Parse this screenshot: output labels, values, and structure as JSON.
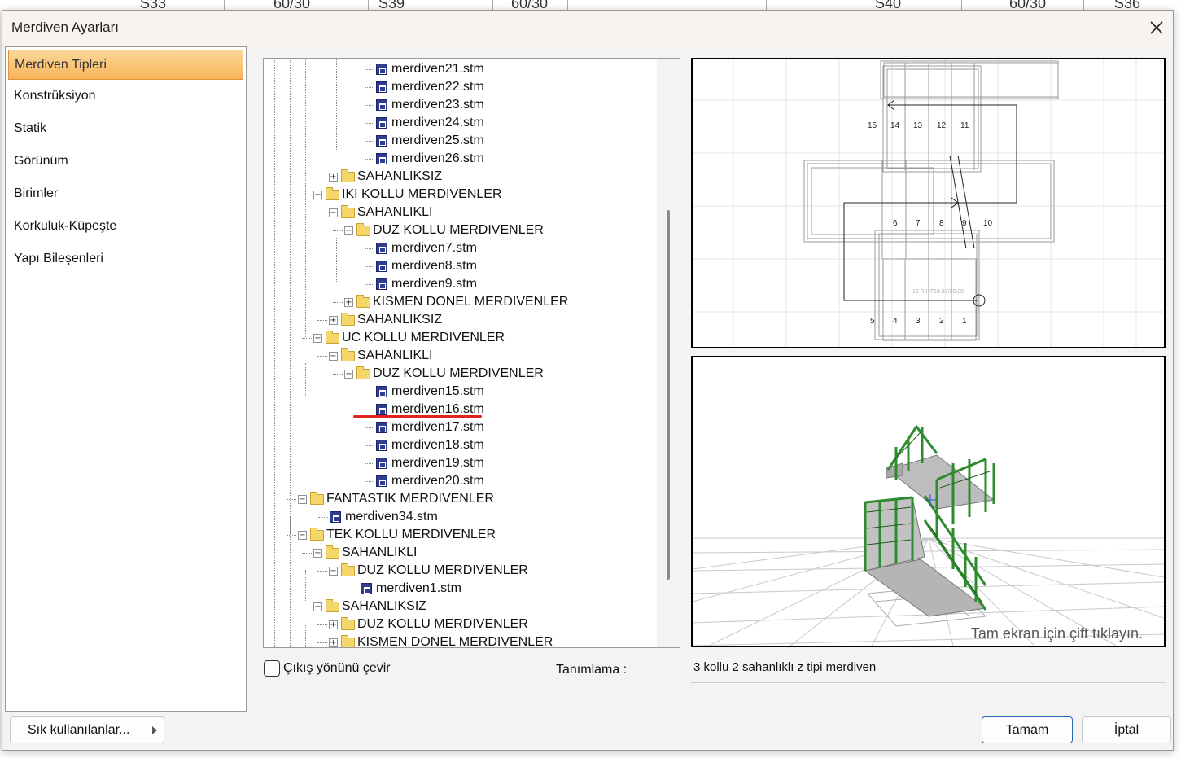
{
  "background": {
    "ruler_labels": [
      "S33",
      "60/30",
      "S39",
      "60/30",
      "S40",
      "60/30",
      "S36"
    ]
  },
  "dialog": {
    "title": "Merdiven Ayarları",
    "close_icon": "close-icon"
  },
  "sidebar": {
    "items": [
      {
        "label": "Merdiven Tipleri",
        "active": true
      },
      {
        "label": "Konstrüksiyon"
      },
      {
        "label": "Statik"
      },
      {
        "label": "Görünüm"
      },
      {
        "label": "Birimler"
      },
      {
        "label": "Korkuluk-Küpeşte"
      },
      {
        "label": "Yapı Bileşenleri"
      }
    ]
  },
  "tree": {
    "nodes": [
      {
        "label": "merdiven21.stm",
        "type": "file"
      },
      {
        "label": "merdiven22.stm",
        "type": "file"
      },
      {
        "label": "merdiven23.stm",
        "type": "file"
      },
      {
        "label": "merdiven24.stm",
        "type": "file"
      },
      {
        "label": "merdiven25.stm",
        "type": "file"
      },
      {
        "label": "merdiven26.stm",
        "type": "file"
      },
      {
        "label": "SAHANLIKSIZ",
        "type": "folder",
        "state": "collapsed"
      },
      {
        "label": "IKI KOLLU MERDIVENLER",
        "type": "folder",
        "state": "expanded"
      },
      {
        "label": "SAHANLIKLI",
        "type": "folder",
        "state": "expanded"
      },
      {
        "label": "DUZ KOLLU MERDIVENLER",
        "type": "folder",
        "state": "expanded"
      },
      {
        "label": "merdiven7.stm",
        "type": "file"
      },
      {
        "label": "merdiven8.stm",
        "type": "file"
      },
      {
        "label": "merdiven9.stm",
        "type": "file"
      },
      {
        "label": "KISMEN DONEL MERDIVENLER",
        "type": "folder",
        "state": "collapsed"
      },
      {
        "label": "SAHANLIKSIZ",
        "type": "folder",
        "state": "collapsed"
      },
      {
        "label": "UC KOLLU MERDIVENLER",
        "type": "folder",
        "state": "expanded"
      },
      {
        "label": "SAHANLIKLI",
        "type": "folder",
        "state": "expanded"
      },
      {
        "label": "DUZ KOLLU MERDIVENLER",
        "type": "folder",
        "state": "expanded"
      },
      {
        "label": "merdiven15.stm",
        "type": "file"
      },
      {
        "label": "merdiven16.stm",
        "type": "file",
        "selected": true
      },
      {
        "label": "merdiven17.stm",
        "type": "file"
      },
      {
        "label": "merdiven18.stm",
        "type": "file"
      },
      {
        "label": "merdiven19.stm",
        "type": "file"
      },
      {
        "label": "merdiven20.stm",
        "type": "file"
      },
      {
        "label": "FANTASTIK MERDIVENLER",
        "type": "folder",
        "state": "expanded"
      },
      {
        "label": "merdiven34.stm",
        "type": "file"
      },
      {
        "label": "TEK KOLLU MERDIVENLER",
        "type": "folder",
        "state": "expanded"
      },
      {
        "label": "SAHANLIKLI",
        "type": "folder",
        "state": "expanded"
      },
      {
        "label": "DUZ KOLLU MERDIVENLER",
        "type": "folder",
        "state": "expanded"
      },
      {
        "label": "merdiven1.stm",
        "type": "file"
      },
      {
        "label": "SAHANLIKSIZ",
        "type": "folder",
        "state": "expanded"
      },
      {
        "label": "DUZ KOLLU MERDIVENLER",
        "type": "folder",
        "state": "collapsed"
      },
      {
        "label": "KISMEN DONEL MERDIVENLER",
        "type": "folder",
        "state": "collapsed"
      }
    ]
  },
  "options": {
    "reverse_exit_label": "Çıkış yönünü çevir",
    "reverse_exit_checked": false,
    "description_label": "Tanımlama :",
    "description_value": "3 kollu 2 sahanlıklı z tipi merdiven"
  },
  "preview_2d": {
    "step_numbers_top": [
      "15",
      "14",
      "13",
      "12",
      "11"
    ],
    "step_numbers_mid": [
      "6",
      "7",
      "8",
      "9",
      "10"
    ],
    "step_numbers_bottom": [
      "5",
      "4",
      "3",
      "2",
      "1"
    ],
    "dimension_note": "15 RIHT18.67/28.00"
  },
  "preview_3d": {
    "hint": "Tam ekran için çift tıklayın.",
    "model_color": "#2e8b2e"
  },
  "buttons": {
    "favorites_label": "Sık kullanılanlar...",
    "ok_label": "Tamam",
    "cancel_label": "İptal"
  },
  "colors": {
    "sidebar_active": "#f7b55a",
    "selection_underline": "#e0241e",
    "primary_button_border": "#2a63b8"
  }
}
